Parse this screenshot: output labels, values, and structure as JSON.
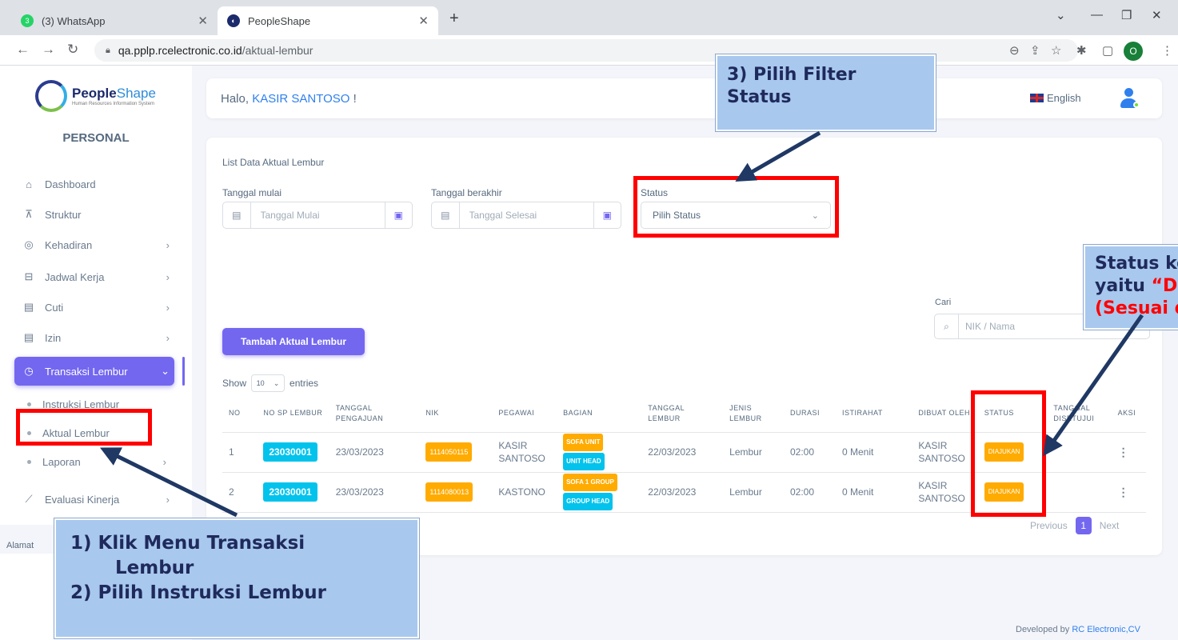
{
  "browser": {
    "tabs": [
      {
        "title": "(3) WhatsApp",
        "badge": "3"
      },
      {
        "title": "PeopleShape"
      }
    ],
    "url_host": "qa.pplp.rcelectronic.co.id",
    "url_path": "/aktual-lembur",
    "profile_initial": "O"
  },
  "sidebar": {
    "logo_bold": "People",
    "logo_light": "Shape",
    "logo_sub": "Human Resources Information System",
    "section": "PERSONAL",
    "items": [
      {
        "label": "Dashboard",
        "icon": "home-icon"
      },
      {
        "label": "Struktur",
        "icon": "sitemap-icon"
      },
      {
        "label": "Kehadiran",
        "icon": "fingerprint-icon"
      },
      {
        "label": "Jadwal Kerja",
        "icon": "briefcase-icon"
      },
      {
        "label": "Cuti",
        "icon": "calendar-icon"
      },
      {
        "label": "Izin",
        "icon": "calendar-icon"
      },
      {
        "label": "Transaksi Lembur",
        "icon": "clock-icon"
      },
      {
        "label": "Evaluasi Kinerja",
        "icon": "chart-line-icon"
      }
    ],
    "sub_items": [
      "Instruksi Lembur",
      "Aktual Lembur",
      "Laporan"
    ],
    "footer_text": "Alamat"
  },
  "topbar": {
    "greeting": "Halo, ",
    "user": "KASIR SANTOSO",
    "greeting_end": " !",
    "language": "English"
  },
  "main": {
    "title": "List Data Aktual Lembur",
    "filters": {
      "start_label": "Tanggal mulai",
      "start_placeholder": "Tanggal Mulai",
      "end_label": "Tanggal berakhir",
      "end_placeholder": "Tanggal Selesai",
      "status_label": "Status",
      "status_value": "Pilih Status"
    },
    "search": {
      "label": "Cari",
      "placeholder": "NIK / Nama"
    },
    "add_button": "Tambah Aktual Lembur",
    "show_label": "Show",
    "entries_value": "10",
    "entries_label": "entries",
    "columns": [
      "NO",
      "NO SP LEMBUR",
      "TANGGAL PENGAJUAN",
      "NIK",
      "PEGAWAI",
      "BAGIAN",
      "TANGGAL LEMBUR",
      "JENIS LEMBUR",
      "DURASI",
      "ISTIRAHAT",
      "DIBUAT OLEH",
      "STATUS",
      "TANGGAL DISETUJUI",
      "AKSI"
    ],
    "rows": [
      {
        "no": "1",
        "sp": "23030001",
        "tgl_pengajuan": "23/03/2023",
        "nik": "1114050115",
        "pegawai": "KASIR SANTOSO",
        "bagian1": "SOFA UNIT",
        "bagian2": "UNIT HEAD",
        "tgl_lembur": "22/03/2023",
        "jenis": "Lembur",
        "durasi": "02:00",
        "istirahat": "0 Menit",
        "dibuat": "KASIR SANTOSO",
        "status": "DIAJUKAN",
        "tgl_setuju": ""
      },
      {
        "no": "2",
        "sp": "23030001",
        "tgl_pengajuan": "23/03/2023",
        "nik": "1114080013",
        "pegawai": "KASTONO",
        "bagian1": "SOFA 1 GROUP",
        "bagian2": "GROUP HEAD",
        "tgl_lembur": "22/03/2023",
        "jenis": "Lembur",
        "durasi": "02:00",
        "istirahat": "0 Menit",
        "dibuat": "KASIR SANTOSO",
        "status": "DIAJUKAN",
        "tgl_setuju": ""
      }
    ],
    "pager": {
      "prev": "Previous",
      "page": "1",
      "next": "Next"
    }
  },
  "footer": {
    "prefix": "Developed by ",
    "company": "RC Electronic,CV"
  },
  "annotations": {
    "step3_line1": "3) Pilih Filter",
    "step3_line2": "Status",
    "status_line1": "Status ketika",
    "status_line2a": "yaitu ",
    "status_line2b": "“Diajuk",
    "status_line3": "(Sesuai deng",
    "steps_line1": "1) Klik Menu Transaksi",
    "steps_line2": "Lembur",
    "steps_line3": "2) Pilih Instruksi Lembur"
  },
  "colors": {
    "accent": "#7367f0",
    "info": "#03c3ec",
    "warning": "#ffab00",
    "annotation_red": "#ff0000",
    "callout_bg": "#a8c8ee"
  }
}
